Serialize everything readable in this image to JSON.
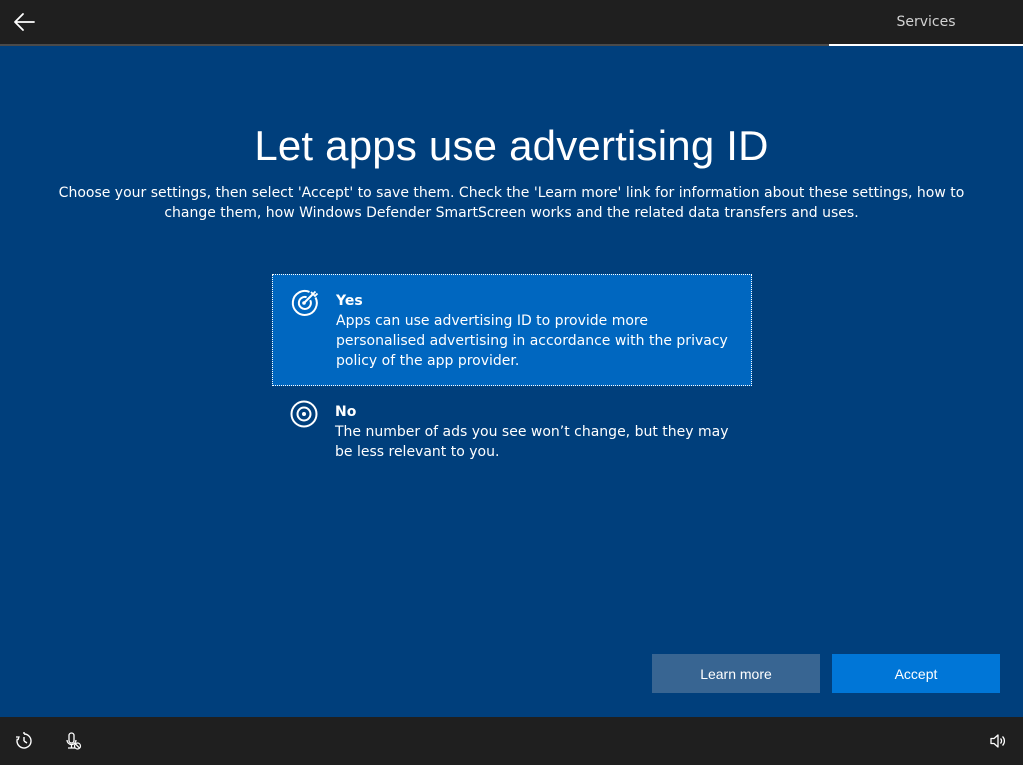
{
  "header": {
    "back_icon": "arrow-left-icon",
    "step_label": "Services"
  },
  "main": {
    "title": "Let apps use advertising ID",
    "subtitle": "Choose your settings, then select 'Accept' to save them. Check the 'Learn more' link for information about these settings, how to change them, how Windows Defender SmartScreen works and the related data transfers and uses.",
    "options": [
      {
        "label": "Yes",
        "description": "Apps can use advertising ID to provide more personalised advertising in accordance with the privacy policy of the app provider.",
        "icon": "target-arrow-icon",
        "selected": true
      },
      {
        "label": "No",
        "description": "The number of ads you see won’t change, but they may be less relevant to you.",
        "icon": "target-icon",
        "selected": false
      }
    ],
    "buttons": {
      "learn_more": "Learn more",
      "accept": "Accept"
    }
  },
  "footer": {
    "icons": [
      "ease-of-access-icon",
      "microphone-muted-icon",
      "volume-icon"
    ]
  },
  "colors": {
    "background": "#003f7c",
    "topbar": "#1f1f1f",
    "selected_option": "#0067c0",
    "learn_more_button": "#386592",
    "accept_button": "#0076d7"
  }
}
